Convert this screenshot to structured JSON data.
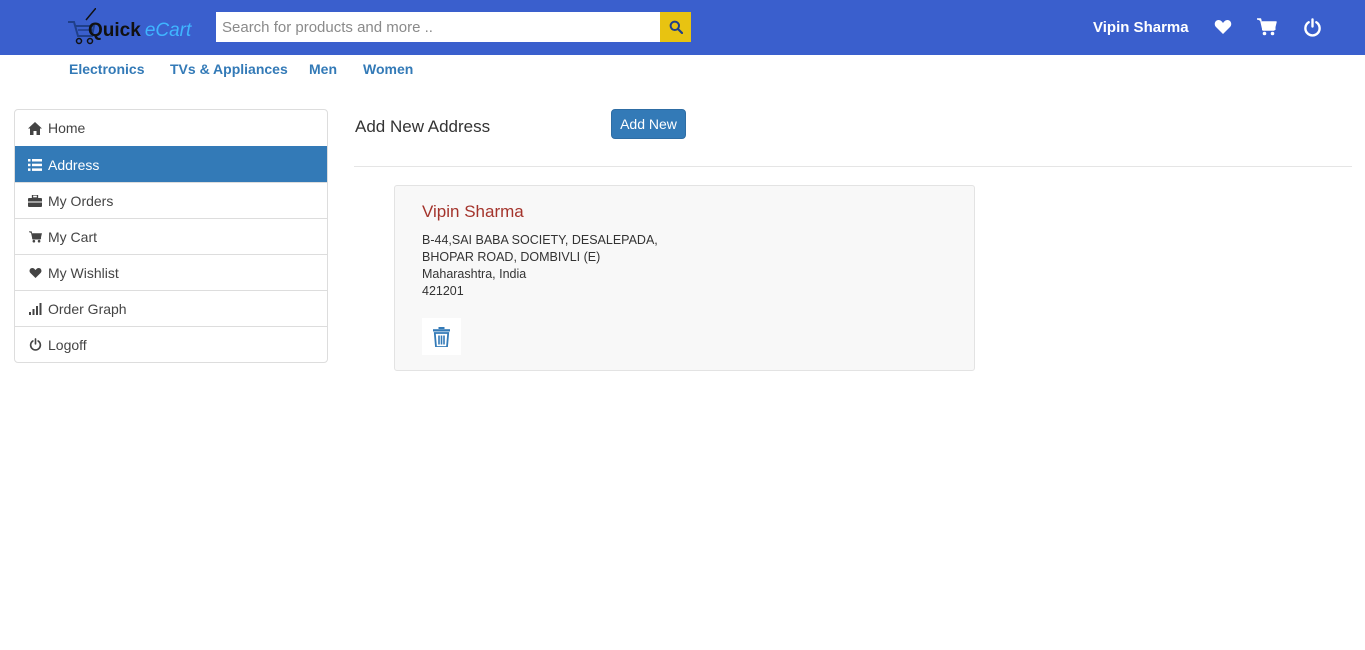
{
  "brand": {
    "logo_text_part1": "Quick",
    "logo_text_part2": "eCart",
    "accent_color": "#3a5fcd"
  },
  "search": {
    "placeholder": "Search for products and more ..",
    "value": "",
    "button_icon": "search-icon"
  },
  "header": {
    "user_name": "Vipin Sharma",
    "icons": [
      "heart-icon",
      "cart-icon",
      "power-icon"
    ]
  },
  "categories": [
    {
      "label": "Electronics"
    },
    {
      "label": "TVs & Appliances"
    },
    {
      "label": "Men"
    },
    {
      "label": "Women"
    }
  ],
  "sidebar": {
    "items": [
      {
        "label": "Home",
        "icon": "home-icon",
        "active": false
      },
      {
        "label": "Address",
        "icon": "list-icon",
        "active": true
      },
      {
        "label": "My Orders",
        "icon": "briefcase-icon",
        "active": false
      },
      {
        "label": "My Cart",
        "icon": "cart-icon",
        "active": false
      },
      {
        "label": "My Wishlist",
        "icon": "heart-icon",
        "active": false
      },
      {
        "label": "Order Graph",
        "icon": "signal-icon",
        "active": false
      },
      {
        "label": "Logoff",
        "icon": "power-icon",
        "active": false
      }
    ]
  },
  "main": {
    "title": "Add New Address",
    "add_button_label": "Add New"
  },
  "address": {
    "name": "Vipin Sharma",
    "line1": "B-44,SAI BABA SOCIETY, DESALEPADA,",
    "line2": "BHOPAR ROAD, DOMBIVLI (E)",
    "line3": "Maharashtra, India",
    "line4": "421201",
    "delete_icon": "trash-icon"
  }
}
